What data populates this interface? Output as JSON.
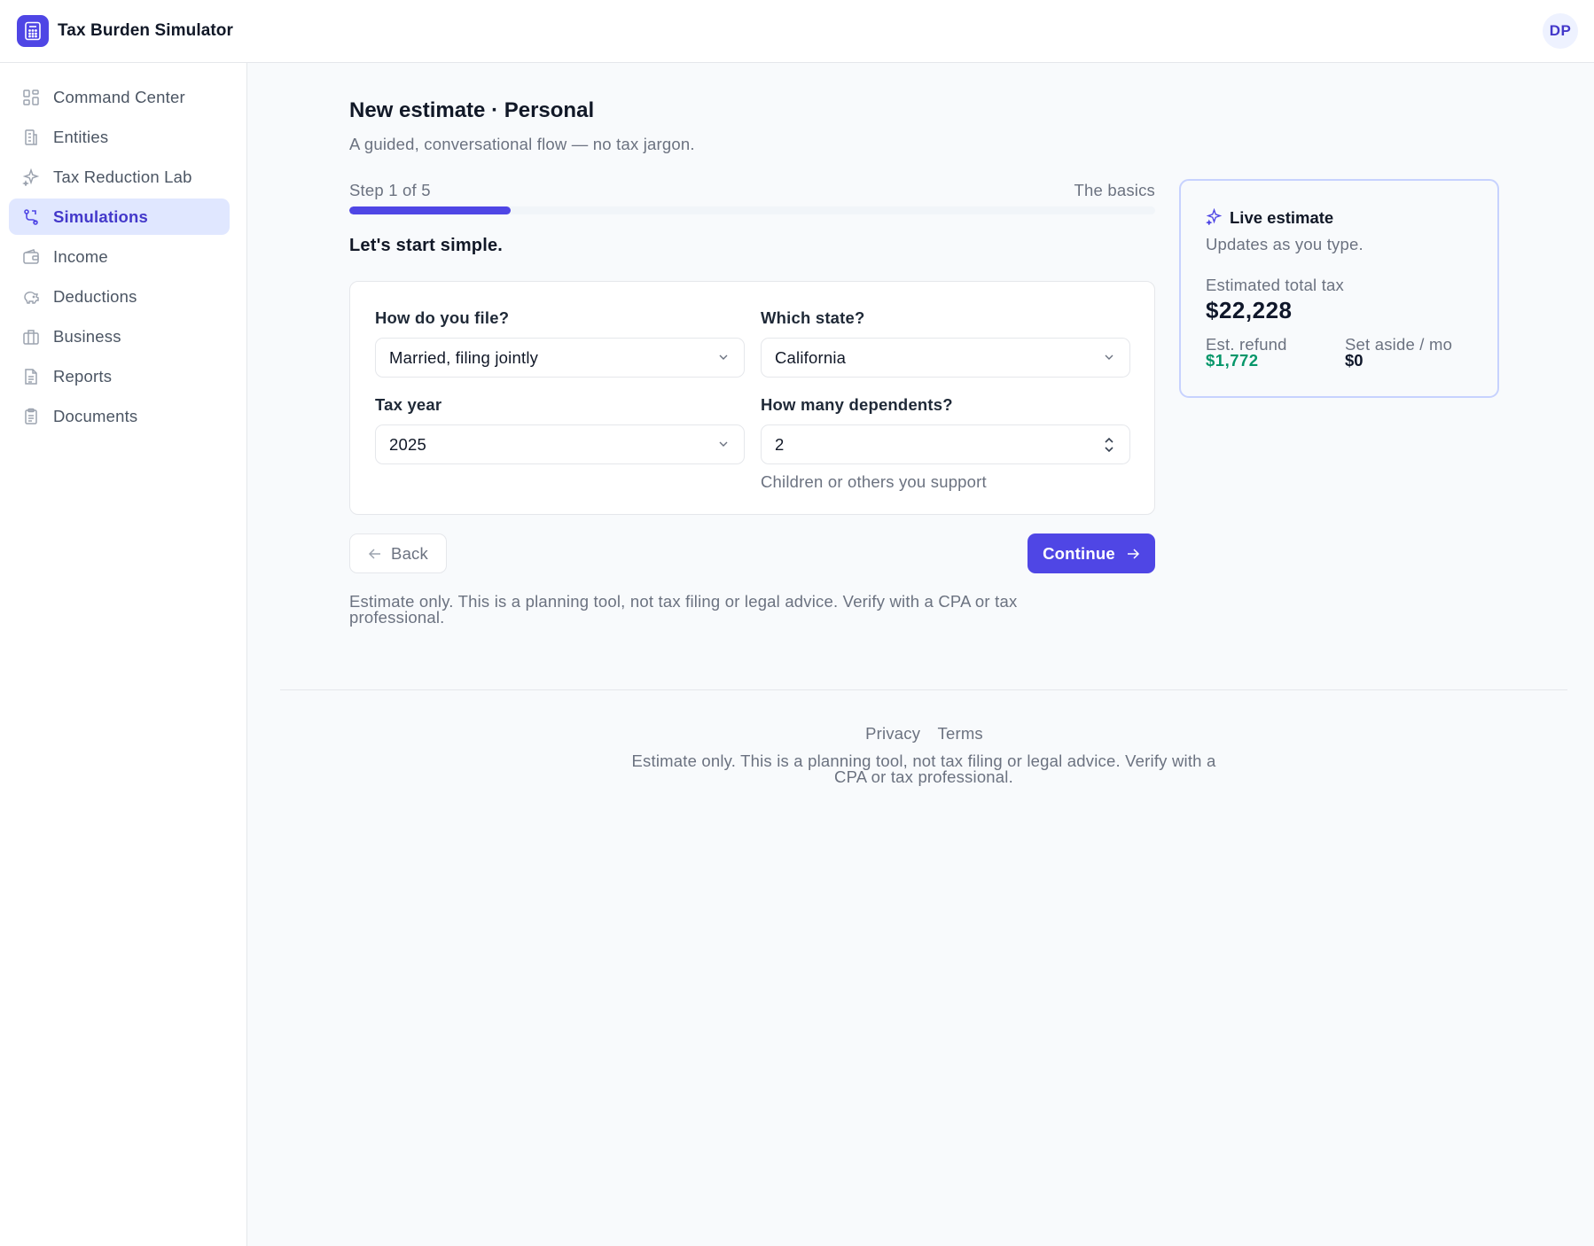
{
  "app": {
    "title": "Tax Burden Simulator",
    "avatar_initials": "DP"
  },
  "sidebar": {
    "items": [
      {
        "label": "Command Center",
        "icon": "grid-icon"
      },
      {
        "label": "Entities",
        "icon": "building-icon"
      },
      {
        "label": "Tax Reduction Lab",
        "icon": "sparkle-icon"
      },
      {
        "label": "Simulations",
        "icon": "route-icon",
        "active": true
      },
      {
        "label": "Income",
        "icon": "wallet-icon"
      },
      {
        "label": "Deductions",
        "icon": "piggy-bank-icon"
      },
      {
        "label": "Business",
        "icon": "briefcase-icon"
      },
      {
        "label": "Reports",
        "icon": "document-icon"
      },
      {
        "label": "Documents",
        "icon": "clipboard-icon"
      }
    ]
  },
  "main": {
    "title": "New estimate · Personal",
    "subtitle": "A guided, conversational flow — no tax jargon.",
    "step_label": "Step 1 of 5",
    "step_name": "The basics",
    "progress": 0.2,
    "section_heading": "Let's start simple.",
    "form": {
      "filing_label": "How do you file?",
      "filing_value": "Married, filing jointly",
      "state_label": "Which state?",
      "state_value": "California",
      "year_label": "Tax year",
      "year_value": "2025",
      "dependents_label": "How many dependents?",
      "dependents_value": "2",
      "dependents_hint": "Children or others you support"
    },
    "back_label": "Back",
    "continue_label": "Continue",
    "disclaimer": "Estimate only. This is a planning tool, not tax filing or legal advice. Verify with a CPA or tax professional."
  },
  "live_estimate": {
    "title": "Live estimate",
    "subtitle": "Updates as you type.",
    "total_label": "Estimated total tax",
    "total_value": "$22,228",
    "refund_label": "Est. refund",
    "refund_value": "$1,772",
    "aside_label": "Set aside / mo",
    "aside_value": "$0"
  },
  "footer": {
    "privacy": "Privacy",
    "terms": "Terms",
    "note": "Estimate only. This is a planning tool, not tax filing or legal advice. Verify with a CPA or tax professional."
  },
  "colors": {
    "accent": "#4f46e5",
    "refund": "#059669",
    "active_bg": "#e0e7ff"
  }
}
